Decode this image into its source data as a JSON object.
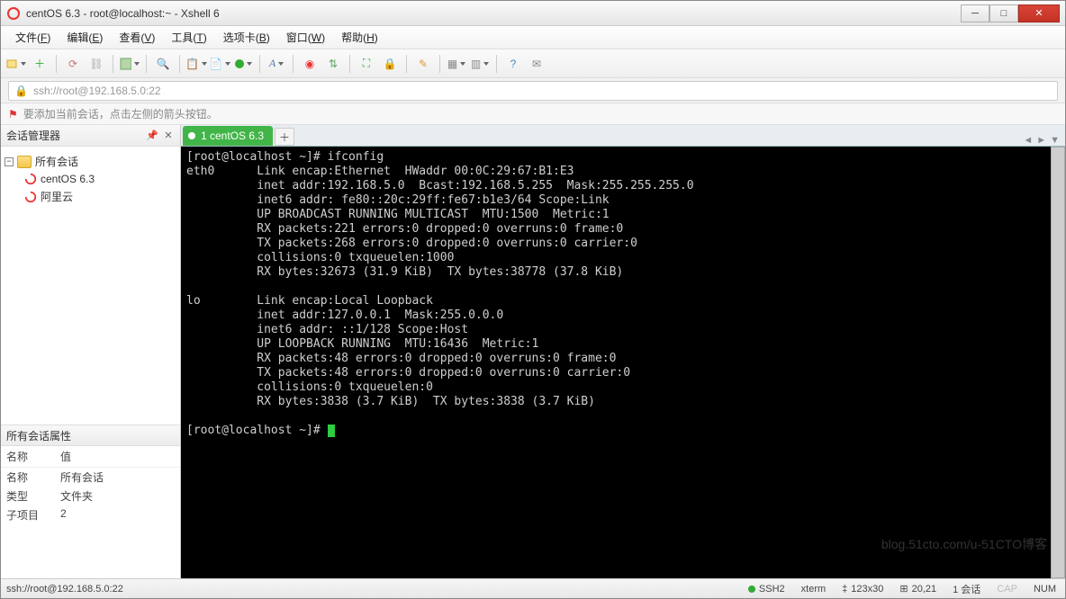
{
  "title": "centOS 6.3 - root@localhost:~ - Xshell 6",
  "menubar": [
    {
      "l": "文件",
      "k": "F"
    },
    {
      "l": "编辑",
      "k": "E"
    },
    {
      "l": "查看",
      "k": "V"
    },
    {
      "l": "工具",
      "k": "T"
    },
    {
      "l": "选项卡",
      "k": "B"
    },
    {
      "l": "窗口",
      "k": "W"
    },
    {
      "l": "帮助",
      "k": "H"
    }
  ],
  "addressbar": {
    "value": "ssh://root@192.168.5.0:22"
  },
  "hint": "要添加当前会话，点击左侧的箭头按钮。",
  "sidebar": {
    "title": "会话管理器",
    "tree": {
      "root": "所有会话",
      "children": [
        "centOS 6.3",
        "阿里云"
      ]
    },
    "propsTitle": "所有会话属性",
    "propsHead": {
      "k": "名称",
      "v": "值"
    },
    "props": [
      {
        "k": "名称",
        "v": "所有会话"
      },
      {
        "k": "类型",
        "v": "文件夹"
      },
      {
        "k": "子项目",
        "v": "2"
      }
    ]
  },
  "tab": {
    "label": "1 centOS 6.3"
  },
  "terminal_lines": [
    "[root@localhost ~]# ifconfig",
    "eth0      Link encap:Ethernet  HWaddr 00:0C:29:67:B1:E3",
    "          inet addr:192.168.5.0  Bcast:192.168.5.255  Mask:255.255.255.0",
    "          inet6 addr: fe80::20c:29ff:fe67:b1e3/64 Scope:Link",
    "          UP BROADCAST RUNNING MULTICAST  MTU:1500  Metric:1",
    "          RX packets:221 errors:0 dropped:0 overruns:0 frame:0",
    "          TX packets:268 errors:0 dropped:0 overruns:0 carrier:0",
    "          collisions:0 txqueuelen:1000",
    "          RX bytes:32673 (31.9 KiB)  TX bytes:38778 (37.8 KiB)",
    "",
    "lo        Link encap:Local Loopback",
    "          inet addr:127.0.0.1  Mask:255.0.0.0",
    "          inet6 addr: ::1/128 Scope:Host",
    "          UP LOOPBACK RUNNING  MTU:16436  Metric:1",
    "          RX packets:48 errors:0 dropped:0 overruns:0 frame:0",
    "          TX packets:48 errors:0 dropped:0 overruns:0 carrier:0",
    "          collisions:0 txqueuelen:0",
    "          RX bytes:3838 (3.7 KiB)  TX bytes:3838 (3.7 KiB)",
    "",
    "[root@localhost ~]# "
  ],
  "statusbar": {
    "left": "ssh://root@192.168.5.0:22",
    "ssh": "SSH2",
    "term": "xterm",
    "size": "123x30",
    "pos": "20,21",
    "sessions": "1 会话",
    "cap": "CAP",
    "num": "NUM"
  },
  "watermark": "blog.51cto.com/u-51CTO博客"
}
